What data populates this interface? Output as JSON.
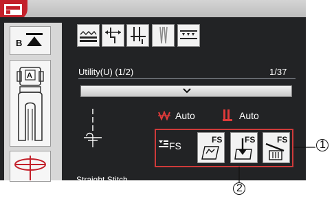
{
  "header": {
    "machine_icon": "sewing-machine-icon",
    "accent_color": "#c3202a"
  },
  "left_panel": {
    "foot_button_label": "B",
    "foot_card_label": "A"
  },
  "toolbar": {
    "icons": [
      "stitch-width-icon",
      "needle-position-icon",
      "needle-stop-icon",
      "twin-needle-icon",
      "feed-dog-icon"
    ]
  },
  "main": {
    "title": "Utility(U) (1/2)",
    "page_count": "1/37",
    "dropdown_icon": "chevron-down-icon",
    "thread_tension_label": "Auto",
    "presser_foot_label": "Auto",
    "fs_label": "FS",
    "fs_buttons": [
      {
        "badge": "FS",
        "icon": "favorite-stitch-save-icon"
      },
      {
        "badge": "FS",
        "icon": "favorite-stitch-load-icon"
      },
      {
        "badge": "FS",
        "icon": "favorite-stitch-delete-icon"
      }
    ],
    "stitch_name": "Straight Stitch"
  },
  "callouts": [
    {
      "number": "1"
    },
    {
      "number": "2"
    }
  ],
  "colors": {
    "screen_bg": "#222325",
    "highlight_border": "#cf3a3a",
    "icon_red": "#c3202a"
  }
}
